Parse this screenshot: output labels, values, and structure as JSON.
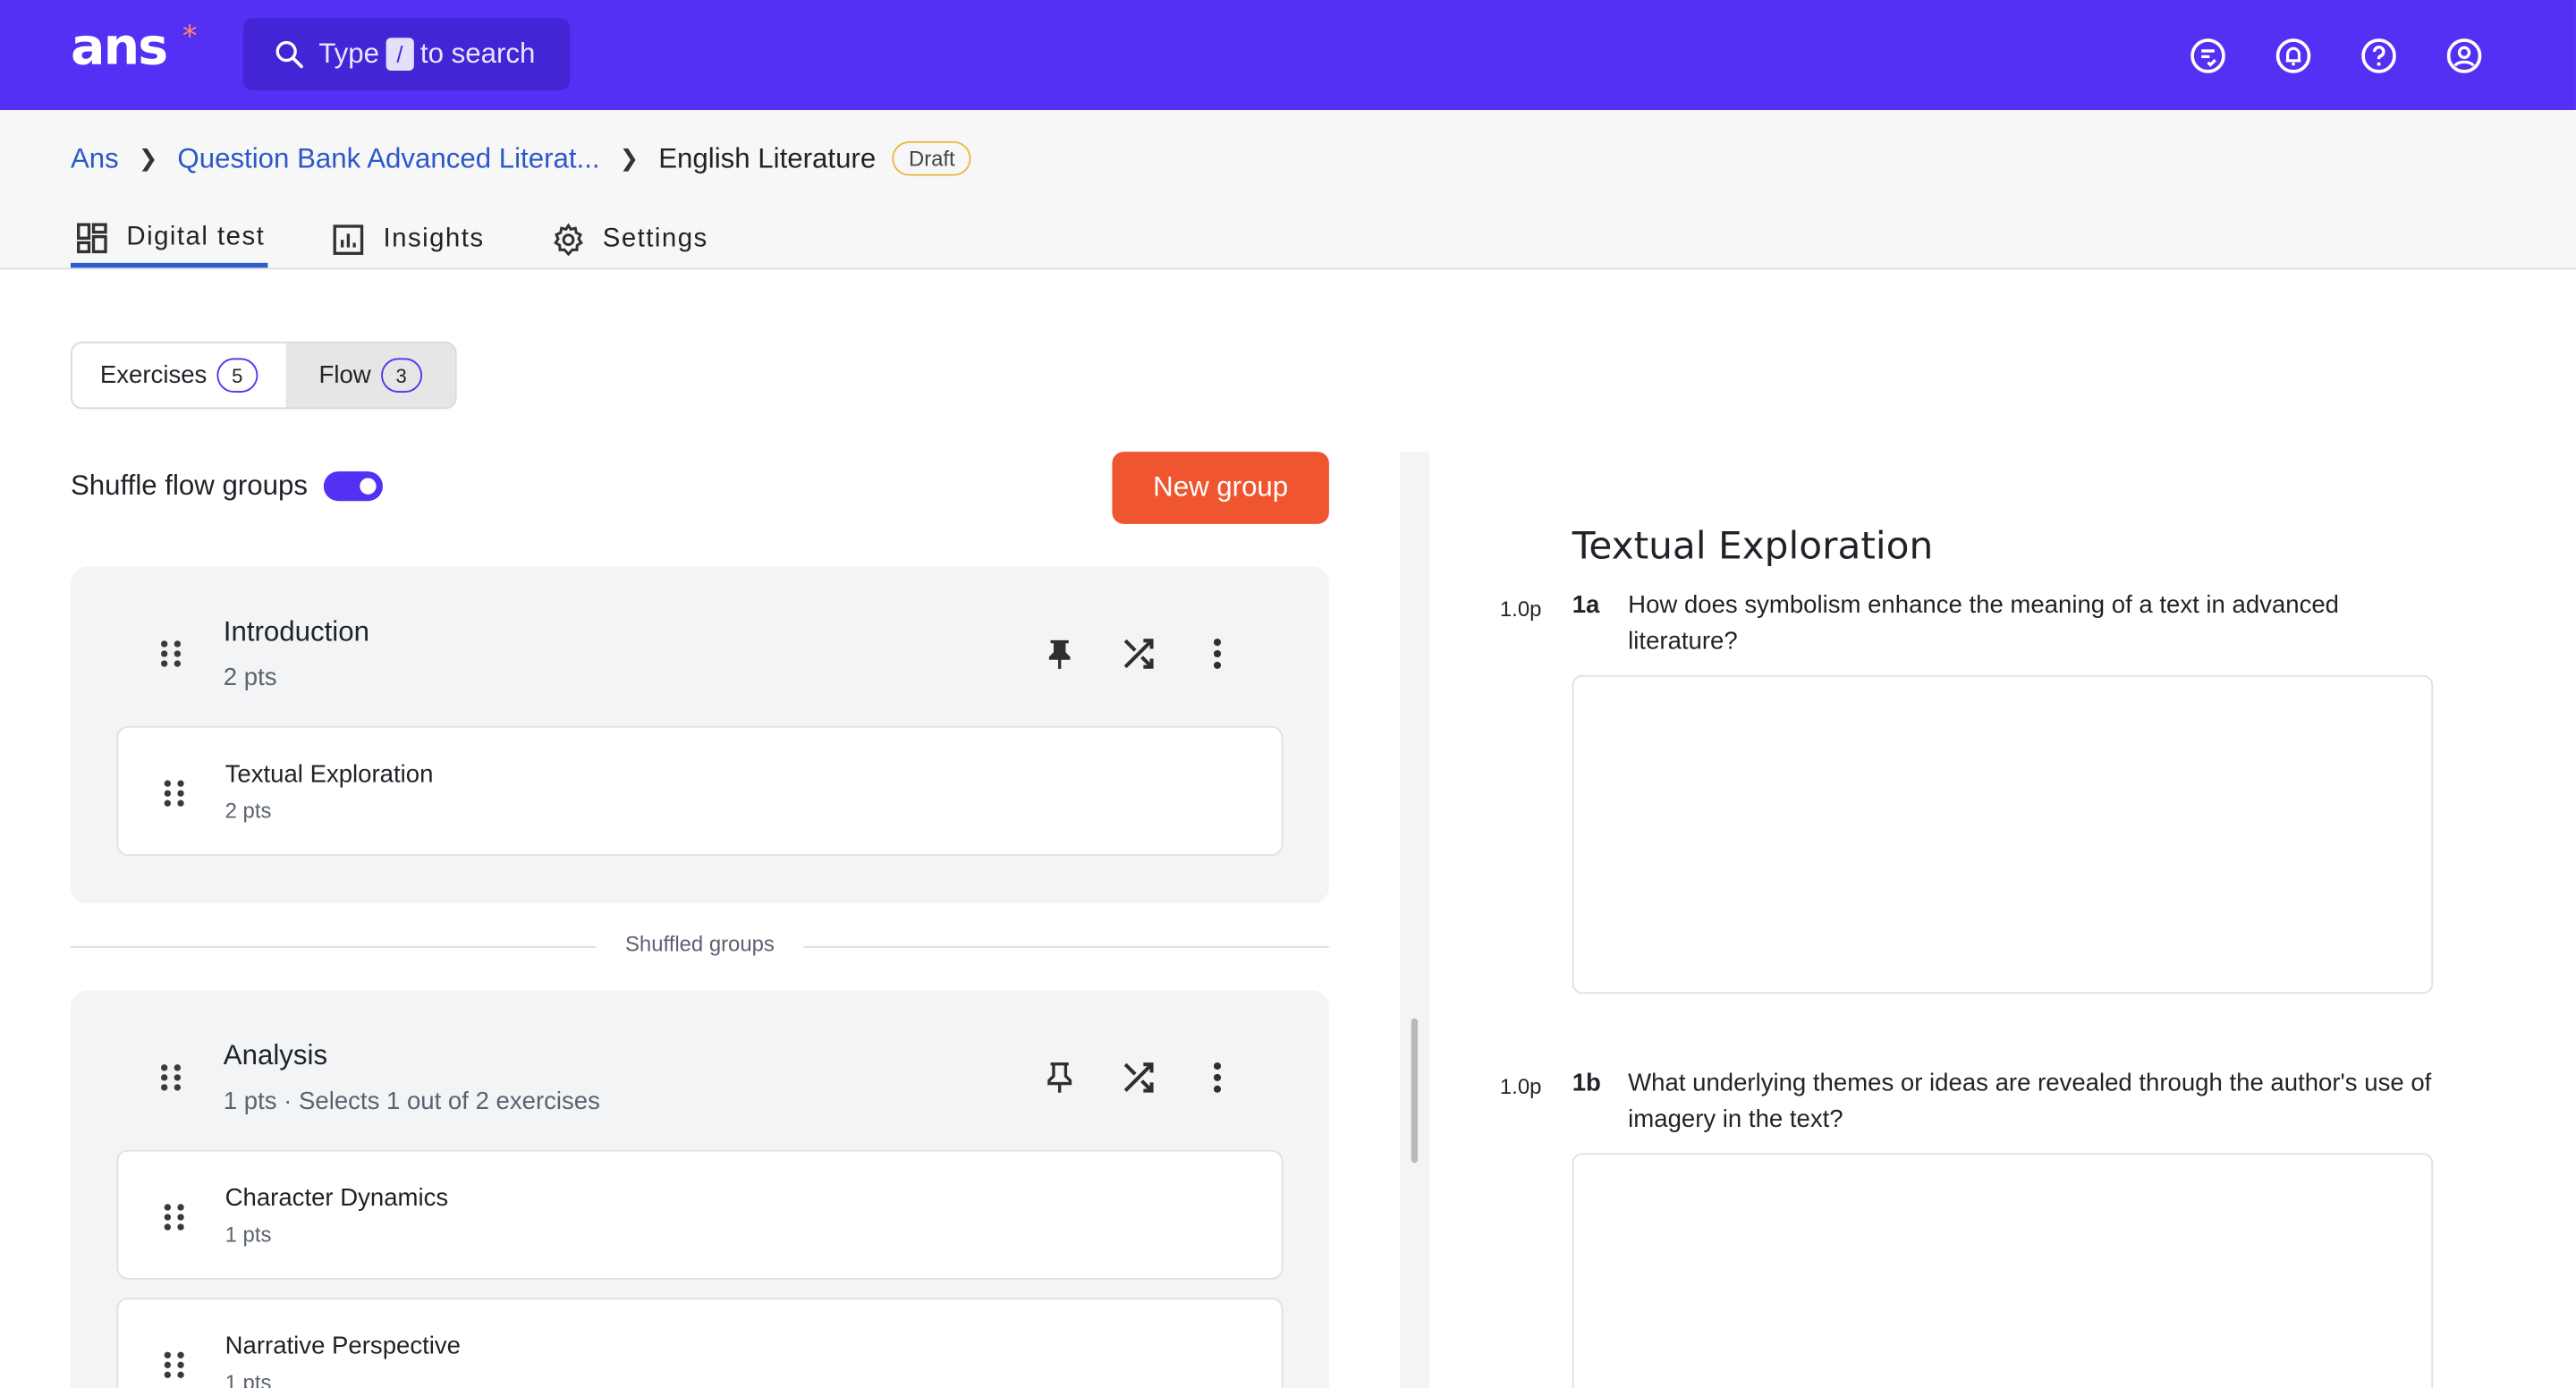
{
  "topbar": {
    "logo": "ans",
    "logo_mark": "*",
    "search": {
      "prefix": "Type",
      "key": "/",
      "suffix": "to search"
    },
    "icons": [
      "tasks-icon",
      "bell-icon",
      "help-icon",
      "account-icon"
    ]
  },
  "breadcrumb": {
    "root": "Ans",
    "parent": "Question Bank Advanced Literat...",
    "current": "English Literature",
    "status": "Draft"
  },
  "tabs": [
    {
      "label": "Digital test",
      "icon": "dashboard-icon",
      "active": true
    },
    {
      "label": "Insights",
      "icon": "chart-icon",
      "active": false
    },
    {
      "label": "Settings",
      "icon": "gear-icon",
      "active": false
    }
  ],
  "segment": {
    "exercises": {
      "label": "Exercises",
      "count": "5"
    },
    "flow": {
      "label": "Flow",
      "count": "3"
    }
  },
  "shuffle": {
    "label": "Shuffle flow groups",
    "enabled": true
  },
  "new_group_label": "New group",
  "groups": [
    {
      "title": "Introduction",
      "subtitle": "2 pts",
      "exercises": [
        {
          "title": "Textual Exploration",
          "pts": "2 pts"
        }
      ]
    },
    {
      "title": "Analysis",
      "subtitle": "1 pts · Selects 1 out of 2 exercises",
      "exercises": [
        {
          "title": "Character Dynamics",
          "pts": "1 pts"
        },
        {
          "title": "Narrative Perspective",
          "pts": "1 pts"
        }
      ]
    }
  ],
  "divider_label": "Shuffled groups",
  "preview": {
    "title": "Textual Exploration",
    "questions": [
      {
        "points": "1.0p",
        "number": "1a",
        "text": "How does symbolism enhance the meaning of a text in advanced literature?"
      },
      {
        "points": "1.0p",
        "number": "1b",
        "text": "What underlying themes or ideas are revealed through the author's use of imagery in the text?"
      }
    ]
  },
  "colors": {
    "brand": "#5330f3",
    "accent": "#ef552e",
    "link": "#2b58c9"
  }
}
